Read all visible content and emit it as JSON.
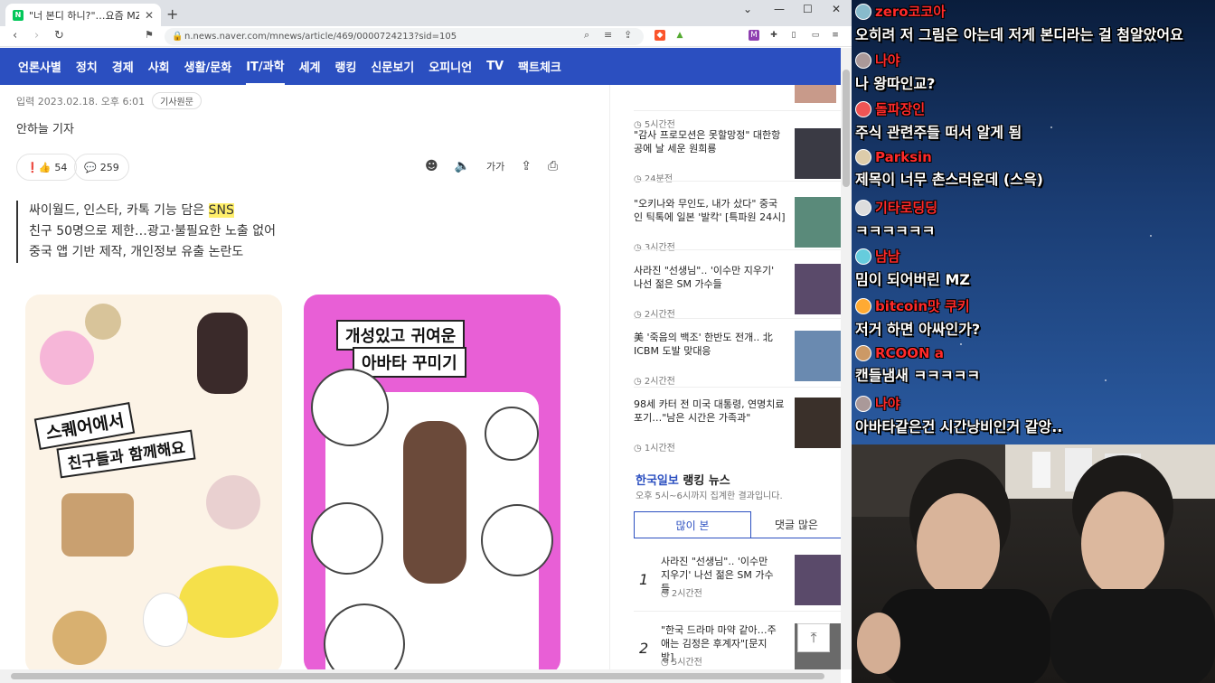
{
  "browser": {
    "tab_title": "\"너 본디 하니?\"…요즘 MZ세대서",
    "new_tab": "+",
    "url": "n.news.naver.com/mnews/article/469/0000724213?sid=105"
  },
  "nav": {
    "categories": [
      "언론사별",
      "정치",
      "경제",
      "사회",
      "생활/문화",
      "IT/과학",
      "세계",
      "랭킹",
      "신문보기",
      "오피니언",
      "TV",
      "팩트체크"
    ]
  },
  "article": {
    "date": "입력 2023.02.18. 오후 6:01",
    "source_btn": "기사원문",
    "reporter": "안하늘 기자",
    "reaction_count": "54",
    "comment_count": "259",
    "font_size_label": "가가",
    "summary_1a": "싸이월드, 인스타, 카톡 기능 담은 ",
    "summary_1b": "SNS",
    "summary_2": "친구 50명으로 제한…광고·불필요한 노출 없어",
    "summary_3": "중국 앱 기반 제작, 개인정보 유출 논란도",
    "img1_banner_1": "스퀘어에서",
    "img1_banner_2": "친구들과 함께해요",
    "img2_banner_1": "개성있고 귀여운",
    "img2_banner_2": "아바타 꾸미기"
  },
  "sidebar": {
    "news": [
      {
        "title": "",
        "time": "5시간전"
      },
      {
        "title": "\"감사 프로모션은 못할망정\" 대한항공에 날 세운 원희룡",
        "time": "24분전"
      },
      {
        "title": "\"오키나와 무인도, 내가 샀다\" 중국인 틱톡에 일본 '발칵' [특파원 24시]",
        "time": "3시간전"
      },
      {
        "title": "사라진 \"선생님\".. '이수만 지우기' 나선 젊은 SM 가수들",
        "time": "2시간전"
      },
      {
        "title": "美 '죽음의 백조' 한반도 전개.. 北 ICBM 도발 맞대응",
        "time": "2시간전"
      },
      {
        "title": "98세 카터 전 미국 대통령, 연명치료 포기…\"남은 시간은 가족과\"",
        "time": "1시간전"
      }
    ],
    "ranking_brand": "한국일보",
    "ranking_title": " 랭킹 뉴스",
    "ranking_sub": "오후 5시~6시까지 집계한 결과입니다.",
    "tab_most_viewed": "많이 본",
    "tab_most_commented": "댓글 많은",
    "ranks": [
      {
        "num": "1",
        "title": "사라진 \"선생님\".. '이수만 지우기' 나선 젊은 SM 가수들",
        "time": "2시간전"
      },
      {
        "num": "2",
        "title": "\"한국 드라마 마약 같아…주애는 김정은 후계자\"[문지방]",
        "time": "5시간전"
      }
    ]
  },
  "chat": [
    {
      "user": "zero코코아",
      "text": "오히려 저 그림은 아는데 저게 본디라는 걸 첨알았어요",
      "color": "#ff2a2a"
    },
    {
      "user": "나야",
      "text": "나 왕따인교?",
      "color": "#ff2a2a"
    },
    {
      "user": "돌파장인",
      "text": "주식 관련주들 떠서 알게 됨",
      "color": "#ff2a2a"
    },
    {
      "user": "Parksin",
      "text": "제목이 너무 촌스러운데 (스윽)",
      "color": "#ff2a2a"
    },
    {
      "user": "기타로딩딩",
      "text": "ㅋㅋㅋㅋㅋㅋ",
      "color": "#ff2a2a"
    },
    {
      "user": "남남",
      "text": "밈이 되어버린 MZ",
      "color": "#ff2a2a"
    },
    {
      "user": "bitcoin맛 쿠키",
      "text": "저거 하면 아싸인가?",
      "color": "#ff2a2a"
    },
    {
      "user": "RCOON a",
      "text": "캔들냄새 ㅋㅋㅋㅋㅋ",
      "color": "#ff2a2a"
    },
    {
      "user": "나야",
      "text": "아바타같은건 시간낭비인거 같앙..",
      "color": "#ff2a2a"
    }
  ]
}
